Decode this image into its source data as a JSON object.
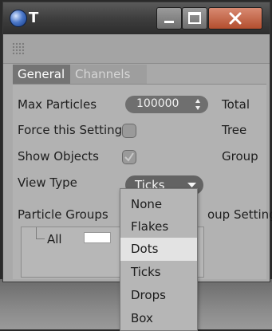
{
  "window": {
    "title": "T",
    "controls": {
      "minimize": "minimize",
      "maximize": "maximize",
      "close": "close"
    }
  },
  "tabs": [
    {
      "label": "General",
      "active": true
    },
    {
      "label": "Channels",
      "active": false
    }
  ],
  "fields": {
    "max_particles_label": "Max Particles",
    "max_particles_value": "100000",
    "force_setting_label": "Force this Setting",
    "force_setting_checked": false,
    "show_objects_label": "Show Objects",
    "show_objects_checked": true,
    "view_type_label": "View Type",
    "view_type_value": "Ticks"
  },
  "right_column": [
    "Total",
    "Tree",
    "Group"
  ],
  "particle_groups": {
    "label": "Particle Groups",
    "group_settings_label": "oup Settings",
    "items": [
      {
        "name": "All",
        "color": "#ffffff"
      }
    ]
  },
  "view_type_options": [
    {
      "label": "None",
      "highlighted": false
    },
    {
      "label": "Flakes",
      "highlighted": false
    },
    {
      "label": "Dots",
      "highlighted": true
    },
    {
      "label": "Ticks",
      "highlighted": false
    },
    {
      "label": "Drops",
      "highlighted": false
    },
    {
      "label": "Box",
      "highlighted": false
    }
  ]
}
